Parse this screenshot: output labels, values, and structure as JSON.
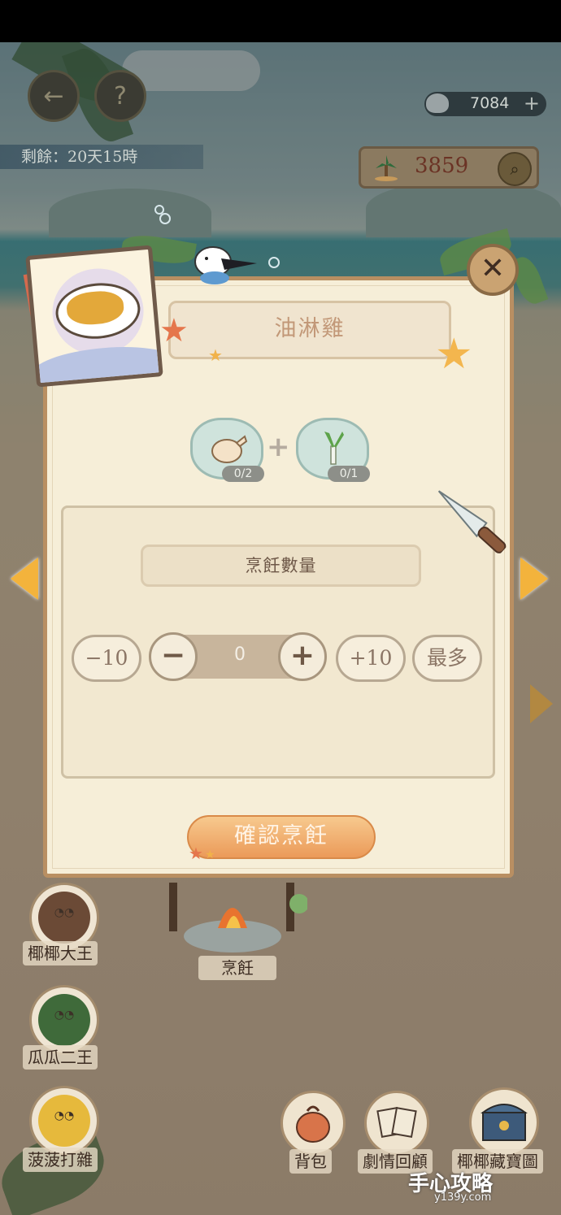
{
  "hud": {
    "back_icon": "back-arrow-icon",
    "help_label": "?",
    "remaining": "剩餘：20天15時",
    "shells": "7084",
    "shells_plus": "+",
    "coins": "3859"
  },
  "modal": {
    "dish_name": "油淋雞",
    "close_label": "✕",
    "ingredients": [
      {
        "name": "chicken",
        "count": "0/2"
      },
      {
        "name": "scallion",
        "count": "0/1"
      }
    ],
    "plus_label": "+",
    "section_title": "烹飪數量",
    "quantity": {
      "minus10": "−10",
      "minus": "−",
      "value": "0",
      "plus": "+",
      "plus10": "+10",
      "max": "最多"
    },
    "confirm": "確認烹飪"
  },
  "characters": [
    {
      "label": "椰椰大王",
      "color": "#6b4a36"
    },
    {
      "label": "瓜瓜二王",
      "color": "#3f6a3a"
    },
    {
      "label": "菠菠打雜",
      "color": "#e6b93c"
    }
  ],
  "station": {
    "label": "烹飪"
  },
  "menu": [
    {
      "label": "背包",
      "icon": "backpack-icon"
    },
    {
      "label": "劇情回顧",
      "icon": "story-cards-icon"
    },
    {
      "label": "椰椰藏寶圖",
      "icon": "treasure-chest-icon"
    }
  ],
  "watermark": {
    "main": "手心攻略",
    "sub": "y139y.com"
  }
}
